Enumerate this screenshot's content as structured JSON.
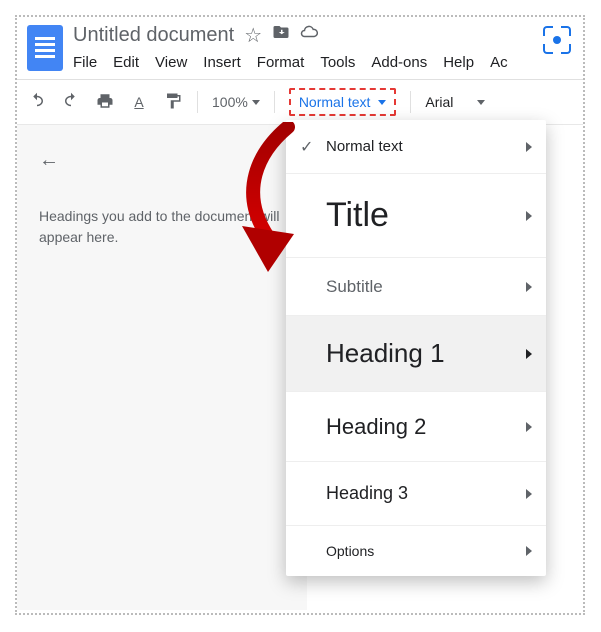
{
  "header": {
    "doc_title": "Untitled document",
    "menu": {
      "file": "File",
      "edit": "Edit",
      "view": "View",
      "insert": "Insert",
      "format": "Format",
      "tools": "Tools",
      "addons": "Add-ons",
      "help": "Help",
      "ac": "Ac"
    }
  },
  "toolbar": {
    "zoom": "100%",
    "style_label": "Normal text",
    "font_label": "Arial"
  },
  "sidebar": {
    "outline_placeholder": "Headings you add to the document will appear here."
  },
  "style_menu": {
    "normal": "Normal text",
    "title": "Title",
    "subtitle": "Subtitle",
    "h1": "Heading 1",
    "h2": "Heading 2",
    "h3": "Heading 3",
    "options": "Options"
  }
}
